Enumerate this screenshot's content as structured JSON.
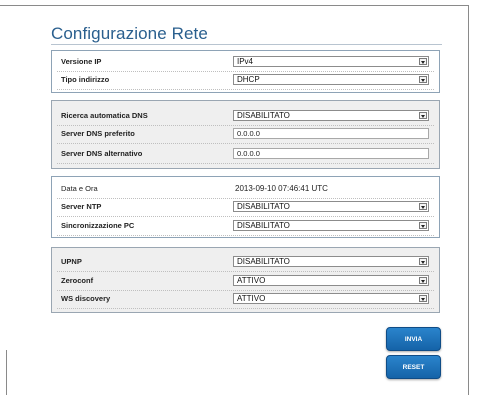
{
  "page": {
    "title": "Configurazione Rete"
  },
  "panel1": {
    "ip_version": {
      "label": "Versione IP",
      "value": "IPv4"
    },
    "address_type": {
      "label": "Tipo indirizzo",
      "value": "DHCP"
    }
  },
  "panel2": {
    "dns_auto": {
      "label": "Ricerca automatica DNS",
      "value": "DISABILITATO"
    },
    "dns_preferred": {
      "label": "Server DNS preferito",
      "value": "0.0.0.0"
    },
    "dns_alternate": {
      "label": "Server DNS alternativo",
      "value": "0.0.0.0"
    }
  },
  "panel3": {
    "datetime": {
      "label": "Data e Ora",
      "value": "2013-09-10 07:46:41 UTC"
    },
    "ntp": {
      "label": "Server NTP",
      "value": "DISABILITATO"
    },
    "pc_sync": {
      "label": "Sincronizzazione PC",
      "value": "DISABILITATO"
    }
  },
  "panel4": {
    "upnp": {
      "label": "UPNP",
      "value": "DISABILITATO"
    },
    "zeroconf": {
      "label": "Zeroconf",
      "value": "ATTIVO"
    },
    "ws_discovery": {
      "label": "WS discovery",
      "value": "ATTIVO"
    }
  },
  "buttons": {
    "send": "INVIA",
    "reset": "RESET"
  }
}
